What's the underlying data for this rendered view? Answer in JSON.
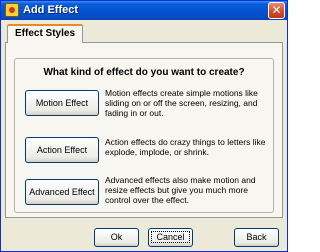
{
  "window": {
    "title": "Add Effect",
    "close_glyph": "✕"
  },
  "tabs": [
    {
      "label": "Effect Styles",
      "active": true
    }
  ],
  "group": {
    "question": "What kind of effect do you want to create?"
  },
  "effects": [
    {
      "button_label": "Motion Effect",
      "description": "Motion effects create simple motions like sliding on or off the screen, resizing, and fading in or out."
    },
    {
      "button_label": "Action Effect",
      "description": "Action effects do crazy things to letters like explode, implode, or shrink."
    },
    {
      "button_label": "Advanced Effect",
      "description": "Advanced effects also make motion and resize effects but give you much more control over the effect."
    }
  ],
  "footer": {
    "ok_label": "Ok",
    "cancel_label": "Cancel",
    "back_label": "Back"
  },
  "colors": {
    "titlebar": "#0453d1",
    "active_tab_accent": "#e68b2c",
    "button_border": "#003c74",
    "close_button": "#d24a2a"
  },
  "icons": {
    "app": "app-icon",
    "close": "close-icon"
  }
}
